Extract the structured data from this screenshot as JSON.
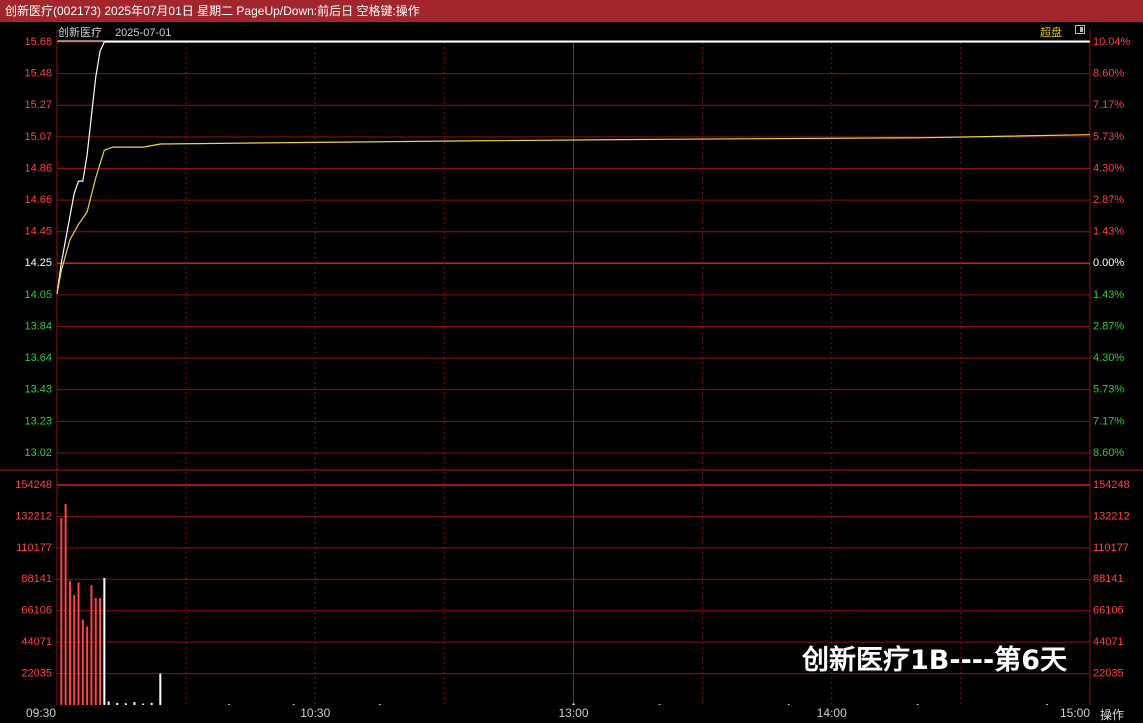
{
  "window": {
    "title": "创新医疗(002173) 2025年07月01日 星期二 PageUp/Down:前后日 空格键:操作"
  },
  "header": {
    "stock_name": "创新医疗",
    "date": "2025-07-01",
    "chao_pan_label": "超盘"
  },
  "watermark": "创新医疗1B----第6天",
  "footer": {
    "operate_label": "操作"
  },
  "colors": {
    "up": "#ff4444",
    "down": "#2ed03a",
    "price_line": "#ffffff",
    "avg_line": "#e8d84a",
    "grid": "#8a1414",
    "title_bar": "#a3262c"
  },
  "chart_data": [
    {
      "type": "line",
      "name_on_chart": "",
      "prev_close": 14.25,
      "y_ticks_left": [
        "15.68",
        "15.48",
        "15.27",
        "15.07",
        "14.86",
        "14.66",
        "14.45",
        "14.25",
        "14.05",
        "13.84",
        "13.64",
        "13.43",
        "13.23",
        "13.02"
      ],
      "y_ticks_right": [
        "10.04%",
        "8.60%",
        "7.17%",
        "5.73%",
        "4.30%",
        "2.87%",
        "1.43%",
        "0.00%",
        "1.43%",
        "2.87%",
        "4.30%",
        "5.73%",
        "7.17%",
        "8.60%"
      ],
      "ylim": [
        13.02,
        15.68
      ],
      "x_ticks": [
        "09:30",
        "10:30",
        "13:00",
        "14:00",
        "15:00"
      ],
      "series": [
        {
          "role": "price",
          "points": [
            [
              0,
              14.05
            ],
            [
              1,
              14.25
            ],
            [
              2,
              14.4
            ],
            [
              3,
              14.55
            ],
            [
              4,
              14.7
            ],
            [
              5,
              14.78
            ],
            [
              6,
              14.78
            ],
            [
              7,
              14.95
            ],
            [
              8,
              15.2
            ],
            [
              9,
              15.45
            ],
            [
              10,
              15.62
            ],
            [
              11,
              15.68
            ],
            [
              240,
              15.68
            ]
          ]
        },
        {
          "role": "average",
          "points": [
            [
              0,
              14.05
            ],
            [
              1,
              14.2
            ],
            [
              3,
              14.4
            ],
            [
              5,
              14.5
            ],
            [
              7,
              14.58
            ],
            [
              9,
              14.8
            ],
            [
              11,
              14.98
            ],
            [
              13,
              15.0
            ],
            [
              20,
              15.0
            ],
            [
              24,
              15.02
            ],
            [
              60,
              15.03
            ],
            [
              95,
              15.04
            ],
            [
              140,
              15.05
            ],
            [
              200,
              15.06
            ],
            [
              240,
              15.08
            ]
          ]
        }
      ]
    },
    {
      "type": "bar",
      "y_ticks": [
        "154248",
        "132212",
        "110177",
        "88141",
        "66106",
        "44071",
        "22035"
      ],
      "ylim": [
        0,
        154248
      ],
      "bars": [
        {
          "minute": 1,
          "value": 131000,
          "dir": "up"
        },
        {
          "minute": 2,
          "value": 141000,
          "dir": "up"
        },
        {
          "minute": 3,
          "value": 87000,
          "dir": "up"
        },
        {
          "minute": 4,
          "value": 77000,
          "dir": "up"
        },
        {
          "minute": 5,
          "value": 86000,
          "dir": "up"
        },
        {
          "minute": 6,
          "value": 60000,
          "dir": "up"
        },
        {
          "minute": 7,
          "value": 55000,
          "dir": "up"
        },
        {
          "minute": 8,
          "value": 84000,
          "dir": "up"
        },
        {
          "minute": 9,
          "value": 75000,
          "dir": "up"
        },
        {
          "minute": 10,
          "value": 75000,
          "dir": "up"
        },
        {
          "minute": 11,
          "value": 89000,
          "dir": "flat"
        },
        {
          "minute": 12,
          "value": 2500,
          "dir": "flat"
        },
        {
          "minute": 14,
          "value": 1500,
          "dir": "flat"
        },
        {
          "minute": 16,
          "value": 1200,
          "dir": "flat"
        },
        {
          "minute": 18,
          "value": 2000,
          "dir": "flat"
        },
        {
          "minute": 20,
          "value": 1000,
          "dir": "flat"
        },
        {
          "minute": 22,
          "value": 1500,
          "dir": "flat"
        },
        {
          "minute": 24,
          "value": 22000,
          "dir": "flat"
        },
        {
          "minute": 40,
          "value": 500,
          "dir": "flat"
        },
        {
          "minute": 55,
          "value": 500,
          "dir": "flat"
        },
        {
          "minute": 75,
          "value": 500,
          "dir": "flat"
        },
        {
          "minute": 120,
          "value": 1000,
          "dir": "flat"
        },
        {
          "minute": 140,
          "value": 500,
          "dir": "flat"
        },
        {
          "minute": 170,
          "value": 500,
          "dir": "flat"
        },
        {
          "minute": 200,
          "value": 500,
          "dir": "flat"
        },
        {
          "minute": 230,
          "value": 500,
          "dir": "flat"
        }
      ]
    }
  ]
}
